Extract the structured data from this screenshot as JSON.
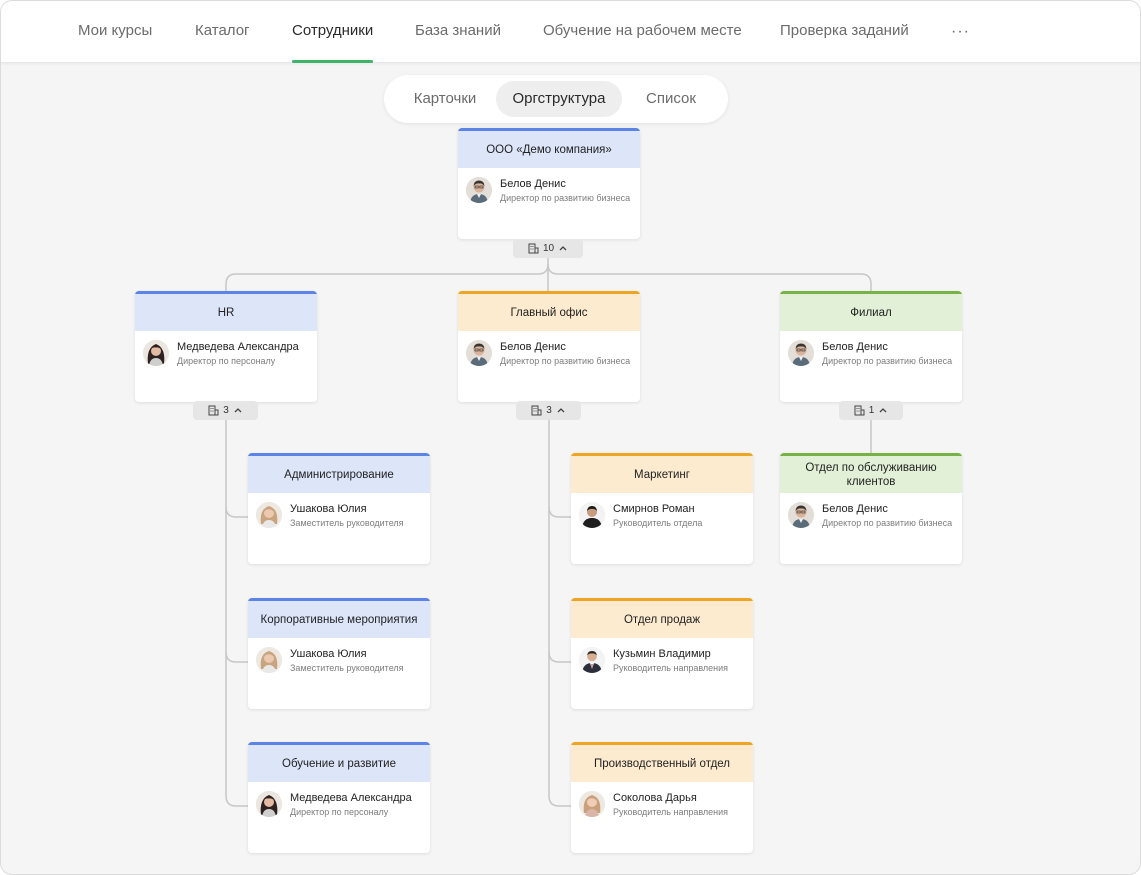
{
  "nav": {
    "items": [
      {
        "label": "Мои курсы"
      },
      {
        "label": "Каталог"
      },
      {
        "label": "Сотрудники"
      },
      {
        "label": "База знаний"
      },
      {
        "label": "Обучение на рабочем месте"
      },
      {
        "label": "Проверка заданий"
      }
    ],
    "more_label": "···",
    "active_index": 2
  },
  "view_switch": {
    "options": [
      {
        "label": "Карточки"
      },
      {
        "label": "Оргструктура"
      },
      {
        "label": "Список"
      }
    ],
    "active_index": 1
  },
  "colors": {
    "accent": "#3fb36b",
    "blue": "#5b84e6",
    "orange": "#eda624",
    "green": "#78b246"
  },
  "org": {
    "root": {
      "title": "ООО «Демо компания»",
      "name": "Белов Денис",
      "role": "Директор по развитию бизнеса",
      "count": "10",
      "avatar": "man-glasses"
    },
    "hr": {
      "title": "HR",
      "name": "Медведева Александра",
      "role": "Директор по персоналу",
      "count": "3",
      "avatar": "woman-dark-hair"
    },
    "main_office": {
      "title": "Главный офис",
      "name": "Белов Денис",
      "role": "Директор по развитию бизнеса",
      "count": "3",
      "avatar": "man-glasses"
    },
    "branch": {
      "title": "Филиал",
      "name": "Белов Денис",
      "role": "Директор по развитию бизнеса",
      "count": "1",
      "avatar": "man-glasses"
    },
    "admin": {
      "title": "Администрирование",
      "name": "Ушакова Юлия",
      "role": "Заместитель руководителя",
      "avatar": "woman-light-hair"
    },
    "corp_events": {
      "title": "Корпоративные мероприятия",
      "name": "Ушакова Юлия",
      "role": "Заместитель руководителя",
      "avatar": "woman-light-hair"
    },
    "training": {
      "title": "Обучение и развитие",
      "name": "Медведева Александра",
      "role": "Директор по персоналу",
      "avatar": "woman-dark-hair"
    },
    "marketing": {
      "title": "Маркетинг",
      "name": "Смирнов Роман",
      "role": "Руководитель отдела",
      "avatar": "man-dark"
    },
    "sales": {
      "title": "Отдел продаж",
      "name": "Кузьмин Владимир",
      "role": "Руководитель направления",
      "avatar": "man-suit"
    },
    "production": {
      "title": "Производственный отдел",
      "name": "Соколова Дарья",
      "role": "Руководитель направления",
      "avatar": "woman-light-hair"
    },
    "customer_service": {
      "title": "Отдел по обслуживанию клиентов",
      "name": "Белов Денис",
      "role": "Директор по развитию бизнеса",
      "avatar": "man-glasses"
    }
  }
}
